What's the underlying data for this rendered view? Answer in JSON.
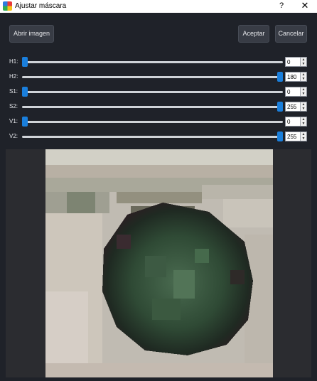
{
  "window": {
    "title": "Ajustar máscara",
    "help_label": "?",
    "close_label": "✕"
  },
  "toolbar": {
    "open_label": "Abrir imagen",
    "accept_label": "Aceptar",
    "cancel_label": "Cancelar"
  },
  "sliders": [
    {
      "label": "H1:",
      "value": "0",
      "max": 180
    },
    {
      "label": "H2:",
      "value": "180",
      "max": 180
    },
    {
      "label": "S1:",
      "value": "0",
      "max": 255
    },
    {
      "label": "S2:",
      "value": "255",
      "max": 255
    },
    {
      "label": "V1:",
      "value": "0",
      "max": 255
    },
    {
      "label": "V2:",
      "value": "255",
      "max": 255
    }
  ],
  "icons": {
    "spin_up": "▲",
    "spin_down": "▼",
    "app_icon": "color-wheel-icon"
  },
  "colors": {
    "accent": "#1a7fdc",
    "background": "#1f2229",
    "button": "#383c45"
  }
}
